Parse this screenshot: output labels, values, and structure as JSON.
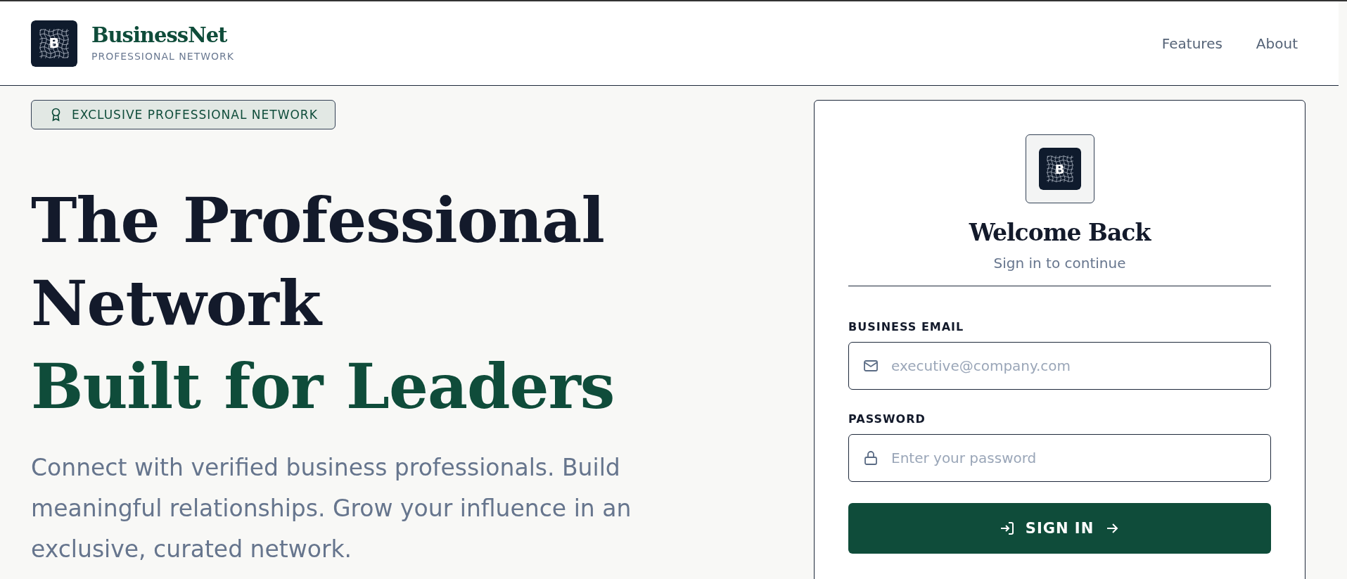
{
  "header": {
    "brand": "BusinessNet",
    "tagline": "PROFESSIONAL NETWORK",
    "logo_letter": "B",
    "nav": [
      {
        "label": "Features"
      },
      {
        "label": "About"
      }
    ]
  },
  "hero": {
    "badge": "EXCLUSIVE PROFESSIONAL NETWORK",
    "headline_lines": [
      "The Professional",
      "Network"
    ],
    "headline_accent": "Built for Leaders",
    "description": "Connect with verified business professionals. Build meaningful relationships. Grow your influence in an exclusive, curated network."
  },
  "login": {
    "logo_letter": "B",
    "title": "Welcome Back",
    "subtitle": "Sign in to continue",
    "fields": [
      {
        "label": "BUSINESS EMAIL",
        "placeholder": "executive@company.com",
        "kind": "email"
      },
      {
        "label": "PASSWORD",
        "placeholder": "Enter your password",
        "kind": "password"
      }
    ],
    "button": "SIGN IN"
  }
}
